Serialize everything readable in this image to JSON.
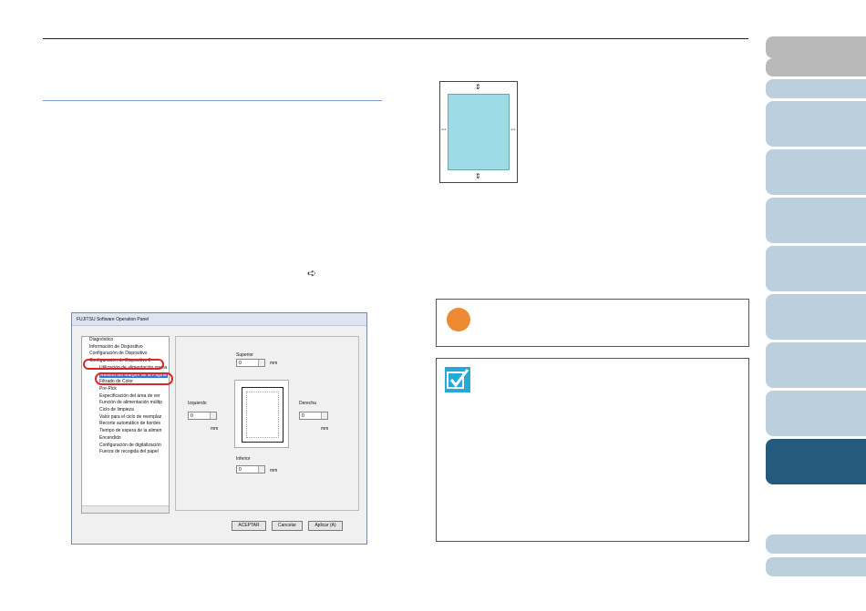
{
  "nav": {
    "tabs": [
      {
        "top": 0,
        "style": "gray"
      }
    ]
  },
  "dialog": {
    "title": "FUJITSU Software Operation Panel",
    "tree": [
      {
        "label": "Diagnóstico",
        "level": 1
      },
      {
        "label": "Información de Dispositivo",
        "level": 1
      },
      {
        "label": "Configuración de Dispositivo",
        "level": 1
      },
      {
        "label": "Configuración de Dispositivo 2",
        "level": 1
      },
      {
        "label": "Utilización de alimentación previa",
        "level": 2
      },
      {
        "label": "Relleno del Margen de la Página",
        "level": 2,
        "selected": true
      },
      {
        "label": "Filtrado de Color",
        "level": 2
      },
      {
        "label": "Pre-Pick",
        "level": 2
      },
      {
        "label": "Especificación del área de ver",
        "level": 2
      },
      {
        "label": "Función de alimentación múltip",
        "level": 2
      },
      {
        "label": "Ciclo de limpieza",
        "level": 2
      },
      {
        "label": "Valor para el ciclo de reemplaz",
        "level": 2
      },
      {
        "label": "Recorte automático de bordes",
        "level": 2
      },
      {
        "label": "Tiempo de espera de la alimen",
        "level": 2
      },
      {
        "label": "Encendido",
        "level": 2
      },
      {
        "label": "Configuración de digitalización",
        "level": 2
      },
      {
        "label": "Fuerza de recogida del papel",
        "level": 2
      }
    ],
    "superior_label": "Superior",
    "inferior_label": "Inferior",
    "izquierdo_label": "Izquierdo",
    "derecha_label": "Derecha",
    "unit": "mm",
    "superior_value": "0",
    "inferior_value": "0",
    "izquierdo_value": "0",
    "derecha_value": "0",
    "ok_label": "ACEPTAR",
    "cancel_label": "Cancelar",
    "apply_label": "Aplicar (A)"
  },
  "icons": {
    "arrow": "arrow-right-icon",
    "attention": "attention-icon",
    "check": "checkmark-icon"
  },
  "colors": {
    "nav_gray": "#b9b9b9",
    "nav_blue": "#bccfdc",
    "nav_active": "#245a7b",
    "paper_fill": "#9ddbe6",
    "highlight": "#d9272e",
    "attention": "#ee8a33",
    "check": "#27a8da"
  }
}
